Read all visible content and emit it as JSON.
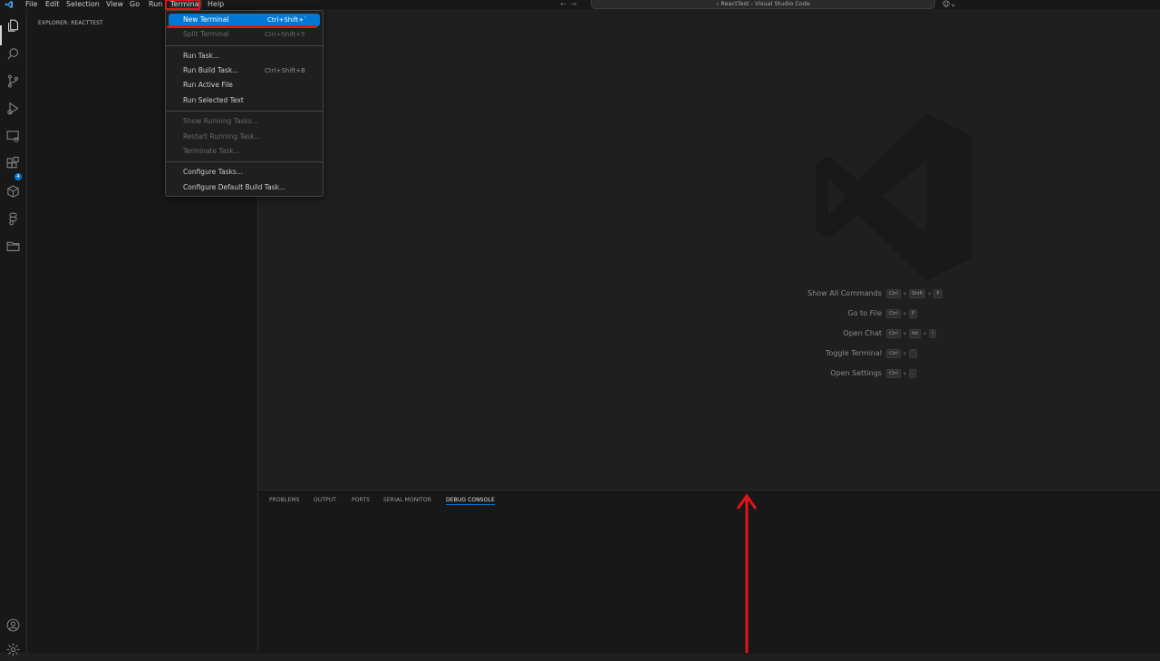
{
  "window": {
    "title": "ReactTest - Visual Studio Code"
  },
  "menubar": {
    "items": [
      {
        "label": "File"
      },
      {
        "label": "Edit"
      },
      {
        "label": "Selection"
      },
      {
        "label": "View"
      },
      {
        "label": "Go"
      },
      {
        "label": "Run"
      },
      {
        "label": "Terminal"
      },
      {
        "label": "Help"
      }
    ],
    "active": "Terminal"
  },
  "sidebar": {
    "title": "EXPLORER: REACTTEST"
  },
  "activitybar": {
    "icons": [
      "files-icon",
      "search-icon",
      "source-control-icon",
      "run-debug-icon",
      "remote-explorer-icon",
      "extensions-icon",
      "packages-icon",
      "figma-icon",
      "folder-icon",
      "account-icon",
      "settings-gear-icon"
    ],
    "extensions_badge": "4"
  },
  "terminal_menu": {
    "groups": [
      [
        {
          "label": "New Terminal",
          "shortcut": "Ctrl+Shift+`",
          "enabled": true,
          "highlighted": true
        },
        {
          "label": "Split Terminal",
          "shortcut": "Ctrl+Shift+5",
          "enabled": false
        }
      ],
      [
        {
          "label": "Run Task...",
          "shortcut": "",
          "enabled": true
        },
        {
          "label": "Run Build Task...",
          "shortcut": "Ctrl+Shift+B",
          "enabled": true
        },
        {
          "label": "Run Active File",
          "shortcut": "",
          "enabled": true
        },
        {
          "label": "Run Selected Text",
          "shortcut": "",
          "enabled": true
        }
      ],
      [
        {
          "label": "Show Running Tasks...",
          "shortcut": "",
          "enabled": false
        },
        {
          "label": "Restart Running Task...",
          "shortcut": "",
          "enabled": false
        },
        {
          "label": "Terminate Task...",
          "shortcut": "",
          "enabled": false
        }
      ],
      [
        {
          "label": "Configure Tasks...",
          "shortcut": "",
          "enabled": true
        },
        {
          "label": "Configure Default Build Task...",
          "shortcut": "",
          "enabled": true
        }
      ]
    ]
  },
  "editor": {
    "shortcuts": [
      {
        "label": "Show All Commands",
        "keys": [
          "Ctrl",
          "Shift",
          "P"
        ]
      },
      {
        "label": "Go to File",
        "keys": [
          "Ctrl",
          "P"
        ]
      },
      {
        "label": "Open Chat",
        "keys": [
          "Ctrl",
          "Alt",
          "I"
        ]
      },
      {
        "label": "Toggle Terminal",
        "keys": [
          "Ctrl",
          "`"
        ]
      },
      {
        "label": "Open Settings",
        "keys": [
          "Ctrl",
          ","
        ]
      }
    ]
  },
  "panel": {
    "tabs": [
      {
        "label": "PROBLEMS",
        "active": false
      },
      {
        "label": "OUTPUT",
        "active": false
      },
      {
        "label": "PORTS",
        "active": false
      },
      {
        "label": "SERIAL MONITOR",
        "active": false
      },
      {
        "label": "DEBUG CONSOLE",
        "active": true
      }
    ]
  },
  "colors": {
    "accent": "#0078d4",
    "annotation": "#e01515",
    "background": "#1f1f1f",
    "sidebar_bg": "#181818"
  }
}
